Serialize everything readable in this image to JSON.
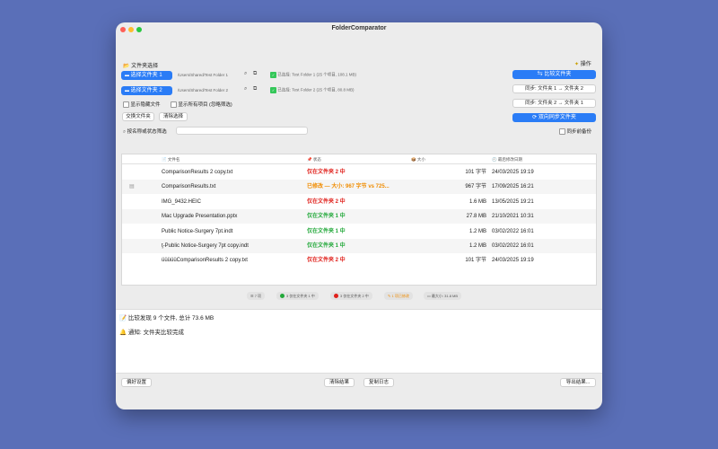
{
  "window": {
    "title": "FolderComparator"
  },
  "folder_section": {
    "title": "文件夹选择",
    "folder1": {
      "button": "选择文件夹 1",
      "path": "/Users/Shared/Test Folder 1",
      "selected_text": "已选择: Test Folder 1 (25 个项目, 108.1 MB)"
    },
    "folder2": {
      "button": "选择文件夹 2",
      "path": "/Users/Shared/Test Folder 2",
      "selected_text": "已选择: Test Folder 2 (25 个项目, 80.8 MB)"
    },
    "show_hidden": "显示隐藏文件",
    "show_all": "显示所有项目 (忽略筛选)",
    "swap": "交换文件夹",
    "clear_selection": "清除选择",
    "filter_label": "按名称或状态筛选",
    "filter_placeholder": ""
  },
  "actions": {
    "title": "操作",
    "compare": "比较文件夹",
    "sync_1_to_2": "同步: 文件夹 1 → 文件夹 2",
    "sync_2_to_1": "同步: 文件夹 2 → 文件夹 1",
    "two_way": "双向同步文件夹",
    "backup": "同步前备份"
  },
  "table": {
    "headers": {
      "name": "文件名",
      "status": "状态",
      "size": "大小",
      "date": "最后修改日期"
    },
    "rows": [
      {
        "name": "ComparisonResults 2 copy.txt",
        "status": "仅在文件夹 2 中",
        "status_color": "#e0201b",
        "size": "101 字节",
        "date": "24/03/2025 19:19"
      },
      {
        "name": "ComparisonResults.txt",
        "status": "已修改 — 大小: 967 字节 vs 725...",
        "status_color": "#f08c00",
        "size": "967 字节",
        "date": "17/09/2025 16:21"
      },
      {
        "name": "IMG_9432.HEIC",
        "status": "仅在文件夹 2 中",
        "status_color": "#e0201b",
        "size": "1.6 MB",
        "date": "13/05/2025 19:21"
      },
      {
        "name": "Mac Upgrade Presentation.pptx",
        "status": "仅在文件夹 1 中",
        "status_color": "#22a83a",
        "size": "27.8 MB",
        "date": "21/10/2021 10:31"
      },
      {
        "name": "Public Notice-Surgery 7pt.indt",
        "status": "仅在文件夹 1 中",
        "status_color": "#22a83a",
        "size": "1.2 MB",
        "date": "03/02/2022 16:01"
      },
      {
        "name": "ţ-Public Notice-Surgery 7pt copy.indt",
        "status": "仅在文件夹 1 中",
        "status_color": "#22a83a",
        "size": "1.2 MB",
        "date": "03/02/2022 16:01"
      },
      {
        "name": "üüüüüComparisonResults 2 copy.txt",
        "status": "仅在文件夹 2 中",
        "status_color": "#e0201b",
        "size": "101 字节",
        "date": "24/03/2025 19:19"
      }
    ]
  },
  "summary": {
    "total": "7 项",
    "only1": "3 仅在文件夹 1 中",
    "only2": "3 仅在文件夹 2 中",
    "modified": "1 项已修改",
    "largest": "最大小: 31.8 MB"
  },
  "log": {
    "line1": "比较发现 9 个文件, 总计 73.6 MB",
    "line2": "通知: 文件夹比较完成"
  },
  "footer": {
    "prefs": "偏好设置",
    "clear_results": "清除结果",
    "copy_log": "复制日志",
    "export": "导出结果..."
  },
  "colors": {
    "accent": "#2a7cf6",
    "red": "#e0201b",
    "orange": "#f08c00",
    "green": "#22a83a"
  }
}
